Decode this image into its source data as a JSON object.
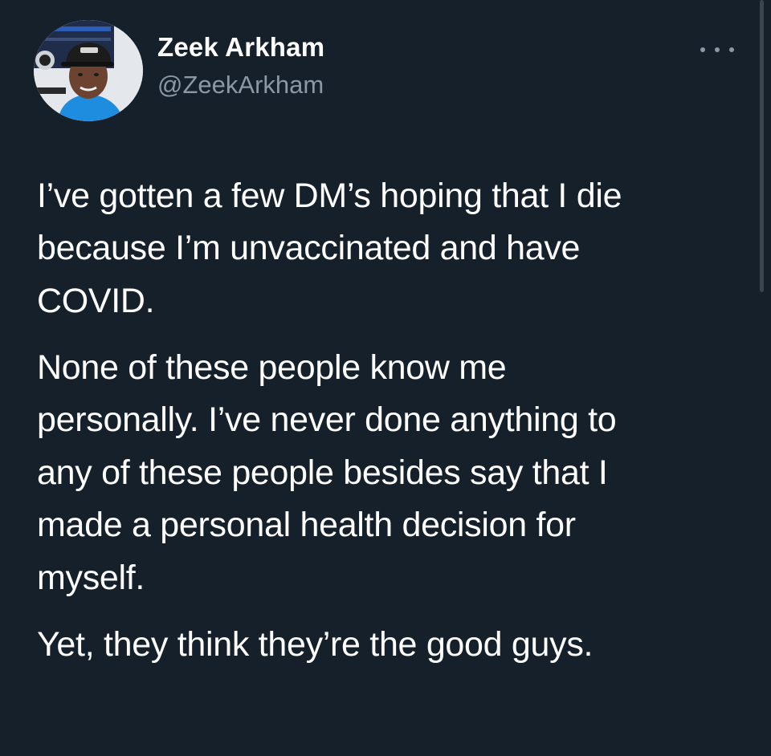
{
  "user": {
    "display_name": "Zeek Arkham",
    "handle": "@ZeekArkham",
    "avatar_icon": "user-avatar-photo"
  },
  "menu": {
    "icon": "more-horizontal-icon"
  },
  "tweet": {
    "paragraphs": [
      "I’ve gotten a few DM’s hoping that I die\nbecause I’m unvaccinated and have\nCOVID.",
      "None of these people know me\npersonally. I’ve never done anything to\nany of these people besides say that I\nmade a personal health decision for\nmyself.",
      "Yet, they think they’re the good guys."
    ]
  },
  "colors": {
    "background": "#15202b",
    "text_primary": "#ffffff",
    "text_secondary": "#8b98a5"
  }
}
